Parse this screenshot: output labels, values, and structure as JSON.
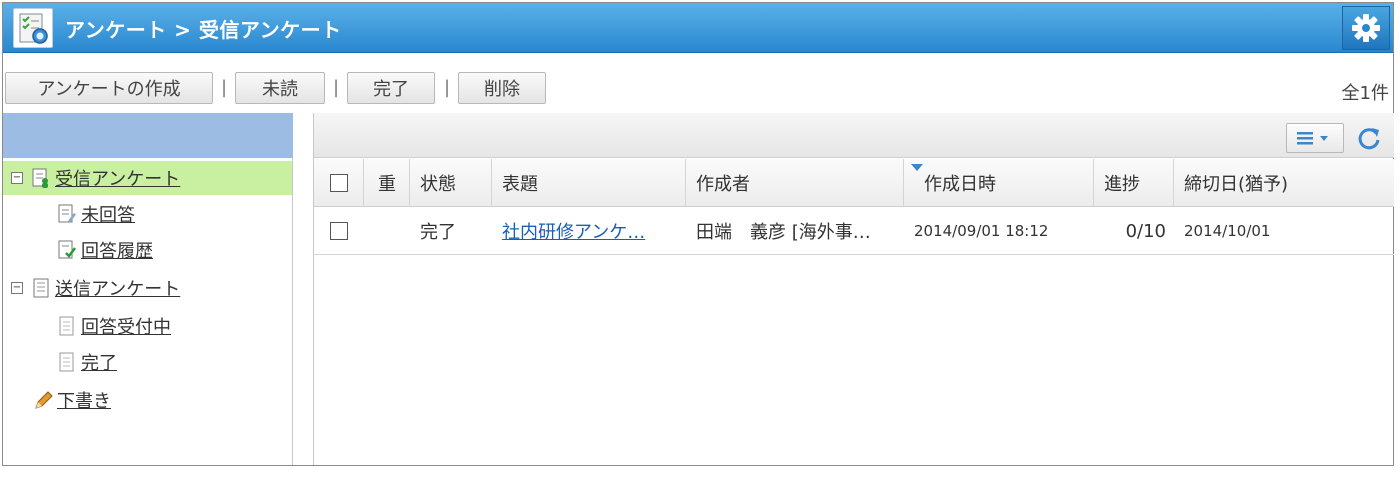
{
  "window": {
    "title": "アンケート > 受信アンケート"
  },
  "toolbar": {
    "create_label": "アンケートの作成",
    "unread_label": "未読",
    "complete_label": "完了",
    "delete_label": "削除",
    "separator": "|",
    "total_count": "全1件"
  },
  "tree": {
    "items": [
      {
        "label": "受信アンケート",
        "toggle": "−",
        "icon": "received-survey-icon",
        "selected": true
      },
      {
        "label": "未回答",
        "icon": "unanswered-icon"
      },
      {
        "label": "回答履歴",
        "icon": "answered-history-icon"
      },
      {
        "label": "送信アンケート",
        "toggle": "−",
        "icon": "sent-survey-icon"
      },
      {
        "label": "回答受付中",
        "icon": "document-icon"
      },
      {
        "label": "完了",
        "icon": "document-icon"
      },
      {
        "label": "下書き",
        "icon": "pencil-icon"
      }
    ]
  },
  "table": {
    "columns": {
      "priority": "重",
      "status": "状態",
      "subject": "表題",
      "author": "作成者",
      "created": "作成日時",
      "progress": "進捗",
      "deadline": "締切日(猶予)"
    },
    "sort_column": "created",
    "rows": [
      {
        "priority": "",
        "status": "完了",
        "subject": "社内研修アンケ…",
        "author": "田端　義彦 [海外事…",
        "created": "2014/09/01 18:12",
        "progress": "0/10",
        "deadline": "2014/10/01"
      }
    ]
  },
  "colors": {
    "titlebar": "#2a87cf",
    "tree_header": "#9dbce4",
    "selected_row": "#c9f0a0",
    "link": "#1a5fb4"
  }
}
